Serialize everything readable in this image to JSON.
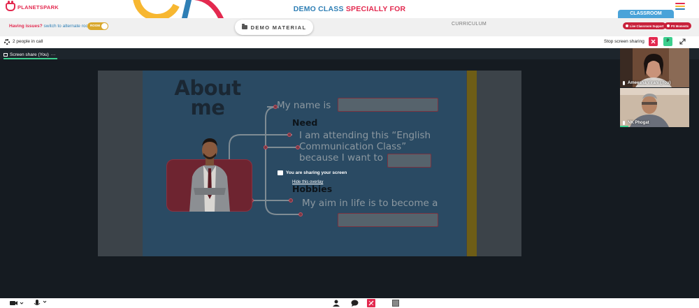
{
  "brand": {
    "logo_text": "PLANETSPARK",
    "accent": "#e3294f",
    "blue": "#2f7fb5"
  },
  "header": {
    "title_part1": "DEMO CLASS",
    "title_part2": "SPECIALLY FOR"
  },
  "toolbar": {
    "issues_question": "Having issues?",
    "issues_link": "switch to alternate room",
    "switch_label": "ROOM",
    "demo_material": "DEMO MATERIAL",
    "curriculum": "CURRICULUM",
    "classroom_tab": "CLASSROOM",
    "live_support": "Live Classroom Support",
    "ps_moments": "PS Moments"
  },
  "callbar": {
    "people_count": "2 people in call",
    "stop_sharing": "Stop screen sharing",
    "p_badge": "P",
    "stop_icon": "close-icon"
  },
  "stage": {
    "share_tab": "Screen share (You)",
    "share_tab_more": "···",
    "overlay_message": "You are sharing your screen",
    "overlay_link": "Hide this overlay"
  },
  "slide": {
    "title_line1": "About",
    "title_line2": "me",
    "name_text": "My name is",
    "need_text": "Need",
    "attending_line1": "I am attending this “English",
    "attending_line2": "Communication Class”",
    "attending_line3": "because I want to",
    "hobbies_text": "Hobbies",
    "aim_text": "My aim in life is to become a"
  },
  "participants": [
    {
      "name": "Ameesha Virani (You)"
    },
    {
      "name": "NK Phogat"
    }
  ],
  "bottombar": {
    "icons": [
      "camera-icon",
      "mic-icon",
      "people-icon",
      "chat-icon",
      "whiteboard-icon",
      "stop-square-icon"
    ]
  }
}
